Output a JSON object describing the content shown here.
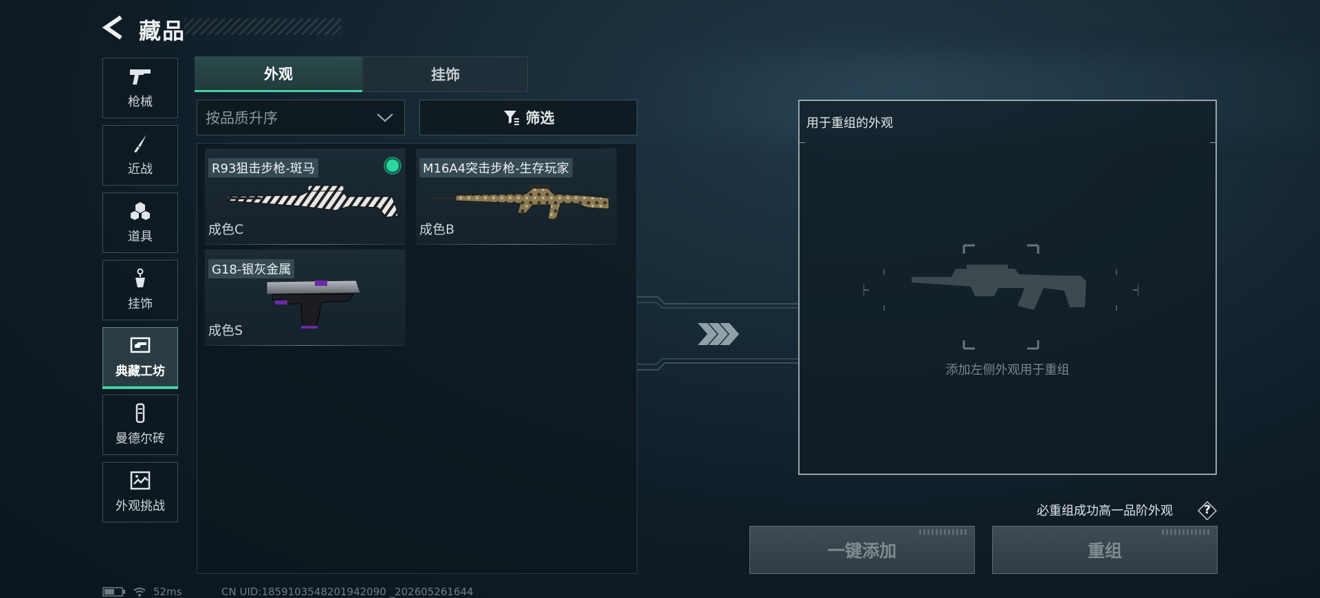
{
  "header": {
    "title": "藏品"
  },
  "sidebar": {
    "items": [
      {
        "label": "枪械",
        "icon": "gun-icon"
      },
      {
        "label": "近战",
        "icon": "knife-icon"
      },
      {
        "label": "道具",
        "icon": "grenade-cluster-icon"
      },
      {
        "label": "挂饰",
        "icon": "charm-icon"
      },
      {
        "label": "典藏工坊",
        "icon": "workshop-icon",
        "active": true
      },
      {
        "label": "曼德尔砖",
        "icon": "mandel-brick-icon"
      },
      {
        "label": "外观挑战",
        "icon": "challenge-map-icon"
      }
    ]
  },
  "tabs": [
    {
      "label": "外观",
      "active": true
    },
    {
      "label": "挂饰",
      "active": false
    }
  ],
  "controls": {
    "sort_label": "按品质升序",
    "filter_label": "筛选"
  },
  "items": [
    {
      "name": "R93狙击步枪-斑马",
      "quality": "成色C",
      "selected": true
    },
    {
      "name": "M16A4突击步枪-生存玩家",
      "quality": "成色B",
      "selected": false
    },
    {
      "name": "G18-银灰金属",
      "quality": "成色S",
      "selected": false
    }
  ],
  "recombine": {
    "panel_title": "用于重组的外观",
    "empty_hint": "添加左侧外观用于重组",
    "note": "必重组成功高一品阶外观",
    "help_symbol": "?",
    "quick_add_label": "一键添加",
    "recombine_label": "重组"
  },
  "status": {
    "ping": "52ms",
    "uid": "CN UID:1859103548201942090 _202605261644"
  },
  "colors": {
    "accent": "#43d3a2",
    "selected_dot": "#2bd6a0"
  }
}
